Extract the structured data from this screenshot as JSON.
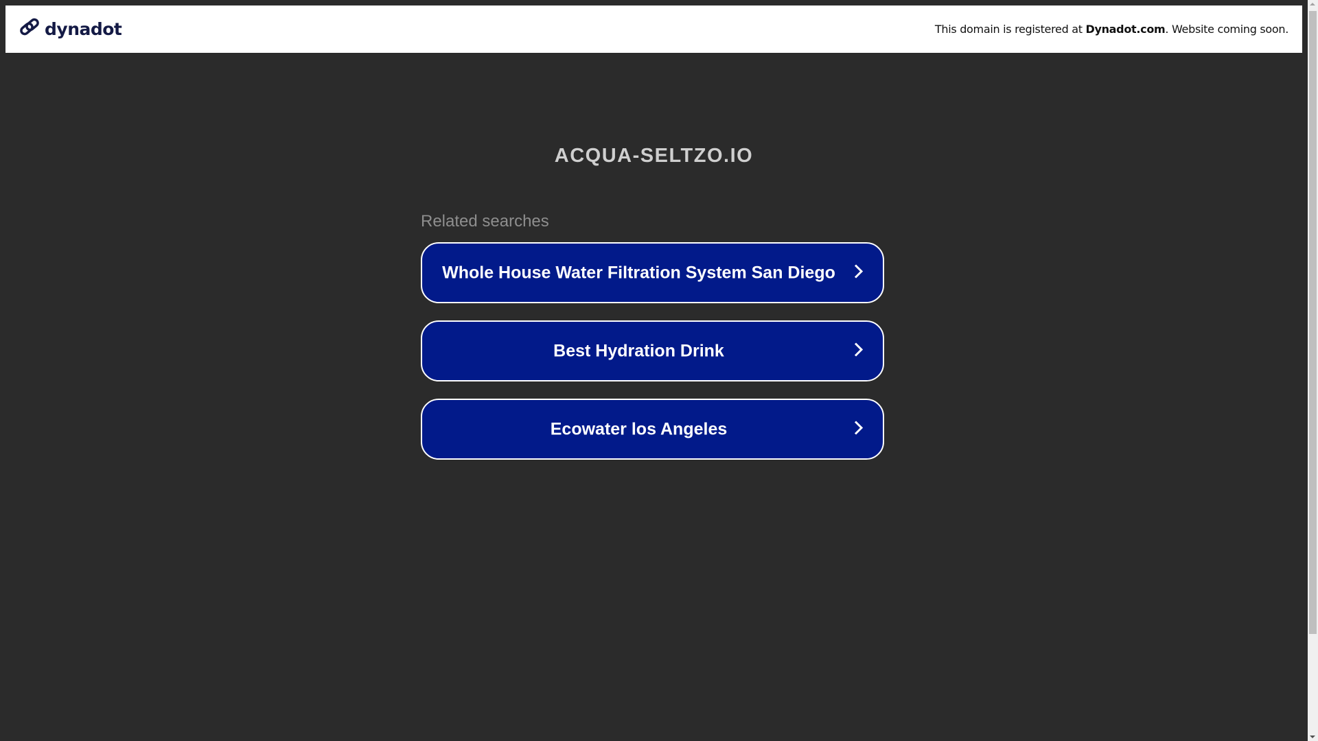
{
  "header": {
    "logo_text": "dynadot",
    "notice_prefix": "This domain is registered at ",
    "notice_link": "Dynadot.com",
    "notice_suffix": ". Website coming soon."
  },
  "domain_title": "ACQUA-SELTZO.IO",
  "related_label": "Related searches",
  "searches": [
    {
      "label": "Whole House Water Filtration System San Diego"
    },
    {
      "label": "Best Hydration Drink"
    },
    {
      "label": "Ecowater los Angeles"
    }
  ],
  "colors": {
    "background": "#2b2b2b",
    "button": "#021a8a",
    "logo": "#141a45"
  }
}
